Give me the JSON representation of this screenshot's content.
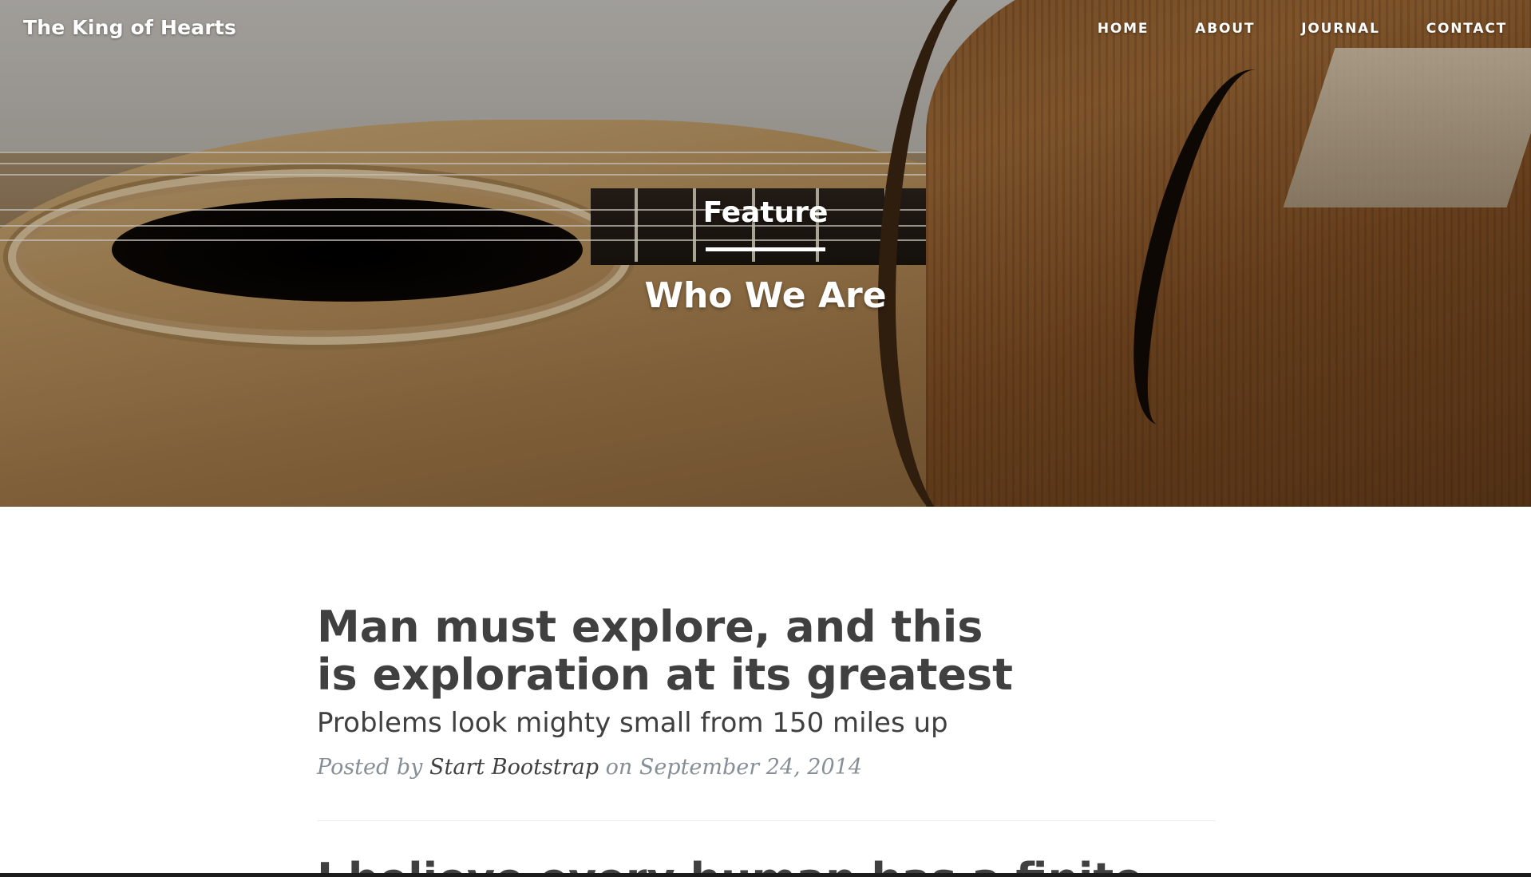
{
  "brand": "The King of Hearts",
  "nav": [
    "HOME",
    "ABOUT",
    "JOURNAL",
    "CONTACT"
  ],
  "hero": {
    "heading": "Feature",
    "subheading": "Who We Are"
  },
  "post": {
    "title": "Man must explore, and this is exploration at its greatest",
    "subtitle": "Problems look mighty small from 150 miles up",
    "meta_prefix": "Posted by",
    "author": "Start Bootstrap",
    "meta_mid": "on September 24, 2014"
  },
  "next_post_title": "I believe every human has a finite"
}
